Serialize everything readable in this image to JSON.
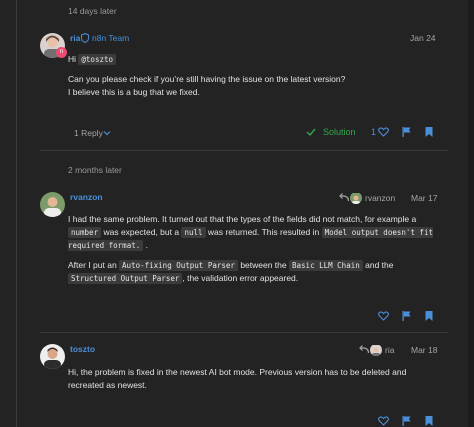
{
  "gaps": {
    "first": "14 days later",
    "second": "2 months later"
  },
  "posts": [
    {
      "username": "ria",
      "team": "n8n Team",
      "date": "Jan 24",
      "mention": "@toszto",
      "greeting": "Hi",
      "line1": "Can you please check if you’re still having the issue on the latest version?",
      "line2": "I believe this is a bug that we fixed.",
      "replies_label": "1 Reply",
      "solution_label": "Solution",
      "like_count": "1"
    },
    {
      "username": "rvanzon",
      "reply_to": "rvanzon",
      "date": "Mar 17",
      "p1": {
        "a": "I had the same problem. It turned out that the types of the fields did not match, for example a",
        "code1": "number",
        "b": "was expected, but a",
        "code2": "null",
        "c": "was returned. This resulted in",
        "code3": "Model output doesn't fit required format.",
        "d": "."
      },
      "p2": {
        "a": "After I put an",
        "code1": "Auto-fixing Output Parser",
        "b": "between the",
        "code2": "Basic LLM Chain",
        "c": "and the",
        "code3": "Structured Output Parser",
        "d": ", the validation error appeared."
      }
    },
    {
      "username": "toszto",
      "reply_to": "ria",
      "date": "Mar 18",
      "line1": "Hi, the problem is fixed in the newest AI bot mode. Previous version has to be deleted and",
      "line2": "recreated as newest."
    }
  ],
  "colors": {
    "accent": "#4a90d9",
    "solution": "#2fa84f",
    "background": "#232323"
  },
  "icons": [
    "shield-icon",
    "chevron-down-icon",
    "check-icon",
    "heart-icon",
    "flag-icon",
    "bookmark-icon",
    "reply-arrow-icon"
  ]
}
